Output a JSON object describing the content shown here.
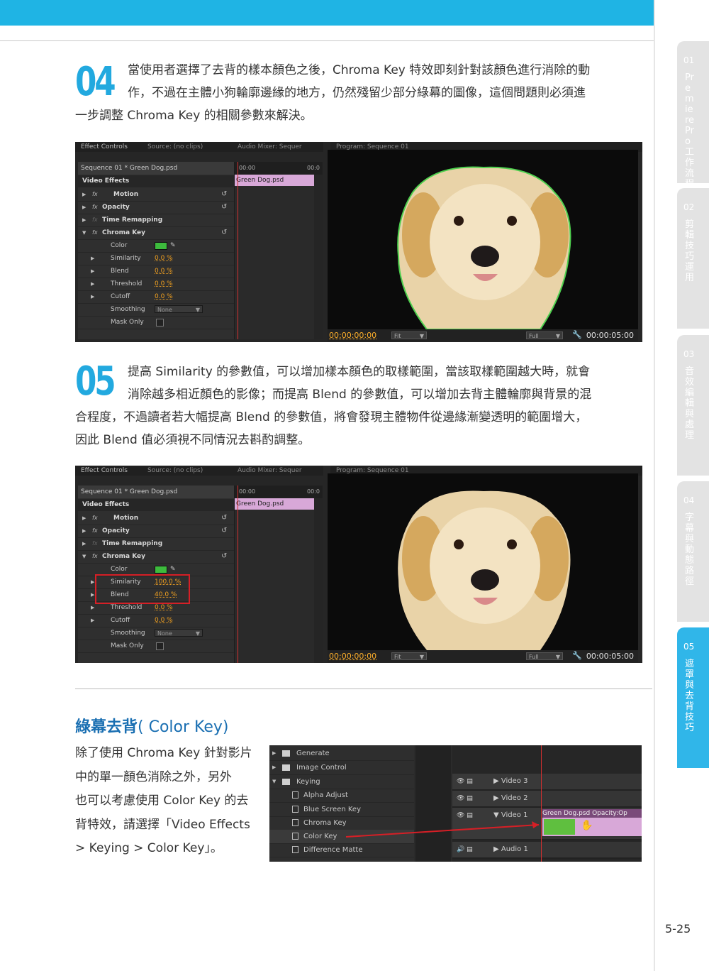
{
  "chapters": [
    {
      "num": "01",
      "title": "Premiere Pro 工作流程",
      "active": false
    },
    {
      "num": "02",
      "title": "剪輯技巧運用",
      "active": false
    },
    {
      "num": "03",
      "title": "音效編輯與處理",
      "active": false
    },
    {
      "num": "04",
      "title": "字幕與動態路徑",
      "active": false
    },
    {
      "num": "05",
      "title": "遮罩與去背技巧",
      "active": true
    }
  ],
  "page_number": "5-25",
  "step4": {
    "num": "04",
    "lines": [
      "當使用者選擇了去背的樣本顏色之後，Chroma Key 特效即刻針對該顏色進行消除的動",
      "作，不過在主體小狗輪廓邊緣的地方，仍然殘留少部分綠幕的圖像，這個問題則必須進",
      "一步調整 Chroma Key 的相關參數來解決。"
    ]
  },
  "step5": {
    "num": "05",
    "lines": [
      "提高 Similarity 的參數值，可以增加樣本顏色的取樣範圍，當該取樣範圍越大時，就會",
      "消除越多相近顏色的影像；而提高 Blend 的參數值，可以增加去背主體輪廓與背景的混",
      "合程度，不過讀者若大幅提高 Blend 的參數值，將會發現主體物件從邊緣漸變透明的範圍增大，",
      "因此 Blend 值必須視不同情況去斟酌調整。"
    ]
  },
  "screens": [
    {
      "tabs": {
        "effect_controls": "Effect Controls",
        "source": "Source: (no clips)",
        "audio_mixer": "Audio Mixer: Sequer",
        "program": "Program: Sequence 01"
      },
      "sequence": "Sequence 01 * Green Dog.psd",
      "video_effects": "Video Effects",
      "ruler_start": "00:00",
      "ruler_end": "00:0",
      "clip": "Green Dog.psd",
      "effects": [
        "Motion",
        "Opacity",
        "Time Remapping",
        "Chroma Key"
      ],
      "params": {
        "color": "Color",
        "similarity": "Similarity",
        "similarity_val": "0.0 %",
        "blend": "Blend",
        "blend_val": "0.0 %",
        "threshold": "Threshold",
        "threshold_val": "0.0 %",
        "cutoff": "Cutoff",
        "cutoff_val": "0.0 %",
        "smoothing": "Smoothing",
        "smoothing_val": "None",
        "mask_only": "Mask Only"
      },
      "timecode": "00:00:00:00",
      "fit": "Fit",
      "quality": "Full",
      "duration": "00:00:05:00",
      "key_color": "#3dbb3d"
    },
    {
      "tabs": {
        "effect_controls": "Effect Controls",
        "source": "Source: (no clips)",
        "audio_mixer": "Audio Mixer: Sequer",
        "program": "Program: Sequence 01"
      },
      "sequence": "Sequence 01 * Green Dog.psd",
      "video_effects": "Video Effects",
      "ruler_start": "00:00",
      "ruler_end": "00:0",
      "clip": "Green Dog.psd",
      "effects": [
        "Motion",
        "Opacity",
        "Time Remapping",
        "Chroma Key"
      ],
      "params": {
        "color": "Color",
        "similarity": "Similarity",
        "similarity_val": "100.0 %",
        "blend": "Blend",
        "blend_val": "40.0 %",
        "threshold": "Threshold",
        "threshold_val": "0.0 %",
        "cutoff": "Cutoff",
        "cutoff_val": "0.0 %",
        "smoothing": "Smoothing",
        "smoothing_val": "None",
        "mask_only": "Mask Only"
      },
      "timecode": "00:00:00:00",
      "fit": "Fit",
      "quality": "Full",
      "duration": "00:00:05:00",
      "key_color": "#3dbb3d"
    }
  ],
  "section": {
    "title_zh": "綠幕去背",
    "title_en": "( Color Key)",
    "lines": [
      "除了使用 Chroma Key 針對影片",
      "中的單一顏色消除之外，另外",
      "也可以考慮使用 Color Key 的去",
      "背特效，請選擇「Video Effects",
      "> Keying > Color Key」。"
    ]
  },
  "project_panel": {
    "folders": [
      "Generate",
      "Image Control",
      "Keying"
    ],
    "keying_items": [
      "Alpha Adjust",
      "Blue Screen Key",
      "Chroma Key",
      "Color Key",
      "Difference Matte"
    ],
    "tracks": [
      "Video 3",
      "Video 2",
      "Video 1",
      "Audio 1"
    ],
    "clip": "Green Dog.psd  Opacity:Op"
  }
}
